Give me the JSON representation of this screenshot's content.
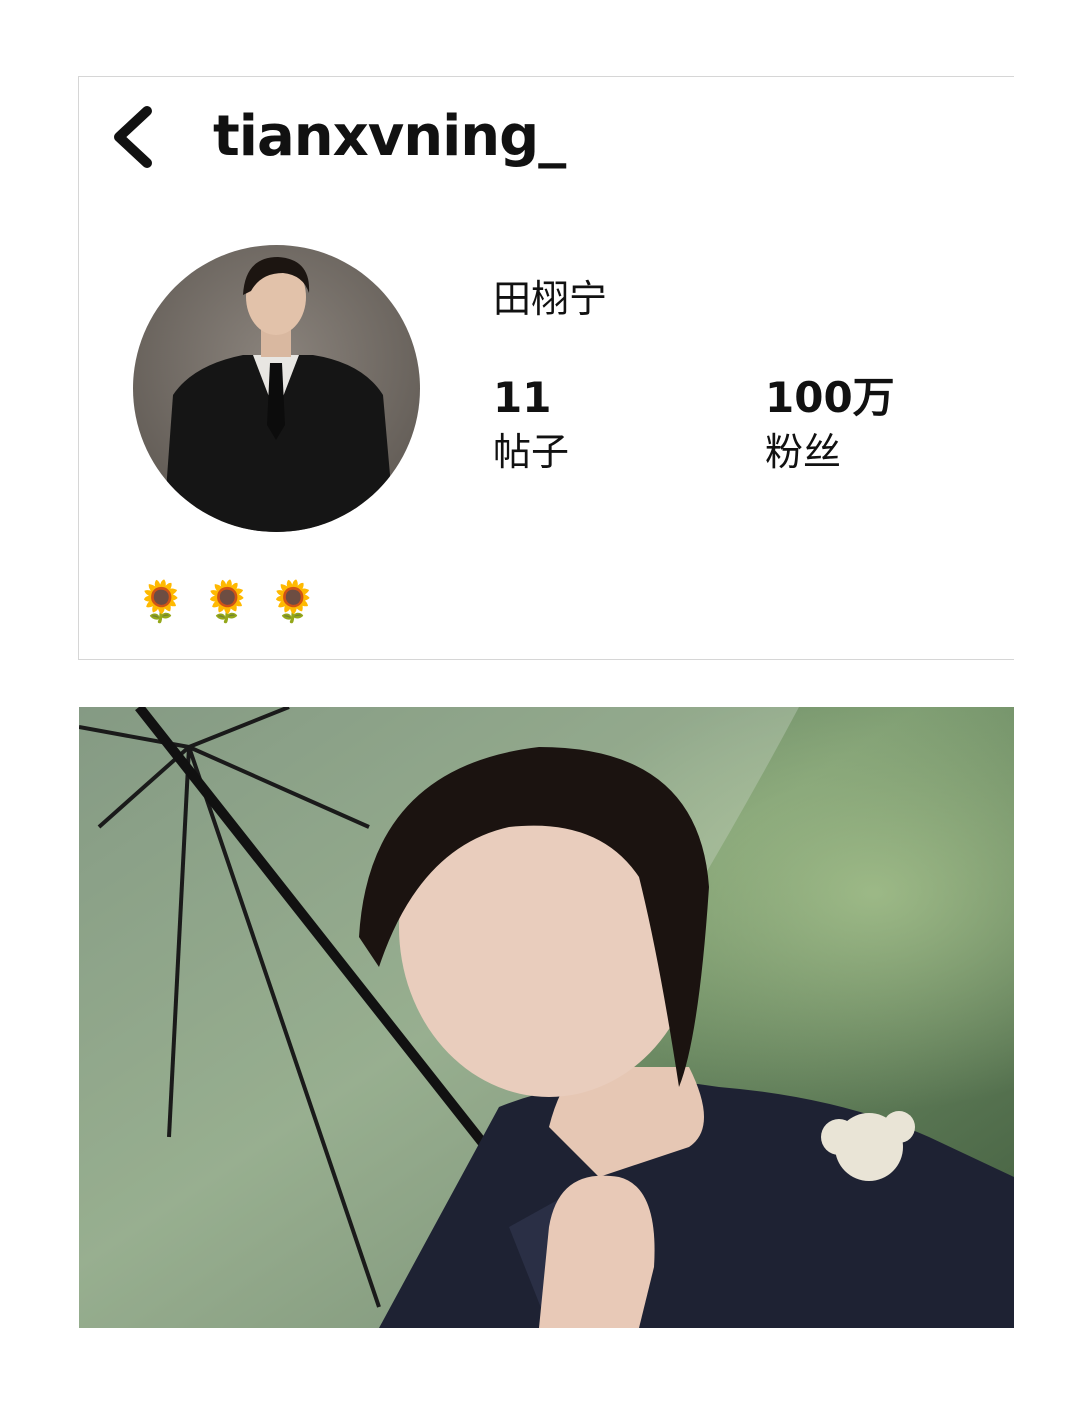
{
  "header": {
    "username": "tianxvning_",
    "back_icon": "chevron-left-icon"
  },
  "profile": {
    "display_name": "田栩宁",
    "posts": {
      "count": "11",
      "label": "帖子"
    },
    "followers": {
      "count": "100万",
      "label": "粉丝"
    },
    "bio": [
      "🌻",
      "🌻",
      "🌻"
    ]
  },
  "colors": {
    "text": "#111111",
    "border": "#d6d6d6"
  }
}
